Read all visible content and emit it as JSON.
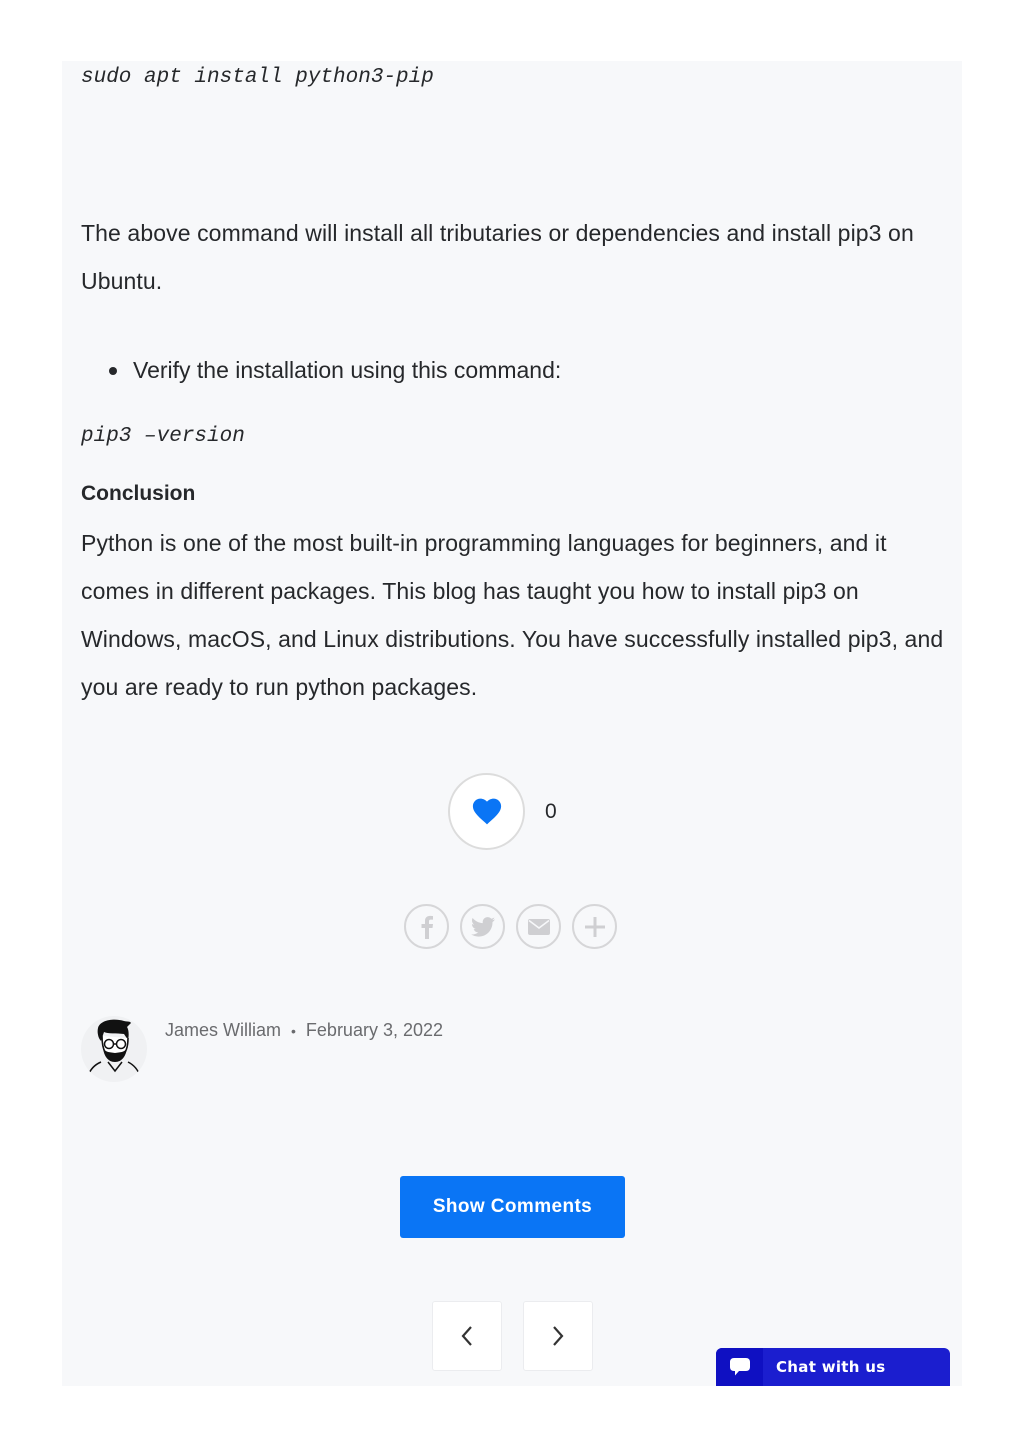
{
  "article": {
    "code_install": "sudo apt install python3-pip",
    "paragraph_install": "The above command will install all tributaries or dependencies and install pip3 on Ubuntu.",
    "bullets": [
      {
        "text": "Verify the installation using this command:"
      }
    ],
    "code_verify": "pip3 –version",
    "conclusion_heading": "Conclusion",
    "conclusion_text": "Python is one of the most built-in programming languages for beginners, and it comes in different packages. This blog has taught you how to install pip3 on Windows, macOS, and Linux distributions. You have successfully installed pip3, and you are ready to run python packages."
  },
  "like": {
    "icon": "heart-icon",
    "count": "0",
    "color": "#0a75f5"
  },
  "share": {
    "buttons": [
      {
        "icon": "facebook-icon"
      },
      {
        "icon": "twitter-icon"
      },
      {
        "icon": "email-icon"
      },
      {
        "icon": "plus-icon"
      }
    ]
  },
  "author": {
    "name": "James William",
    "separator": "•",
    "date": "February 3, 2022"
  },
  "comments": {
    "button_label": "Show Comments",
    "color": "#0a75f5"
  },
  "post_nav": {
    "prev_icon": "chevron-left-icon",
    "next_icon": "chevron-right-icon"
  },
  "chat": {
    "label": "Chat with us",
    "icon": "chat-bubble-icon",
    "color": "#1b1ecf"
  }
}
